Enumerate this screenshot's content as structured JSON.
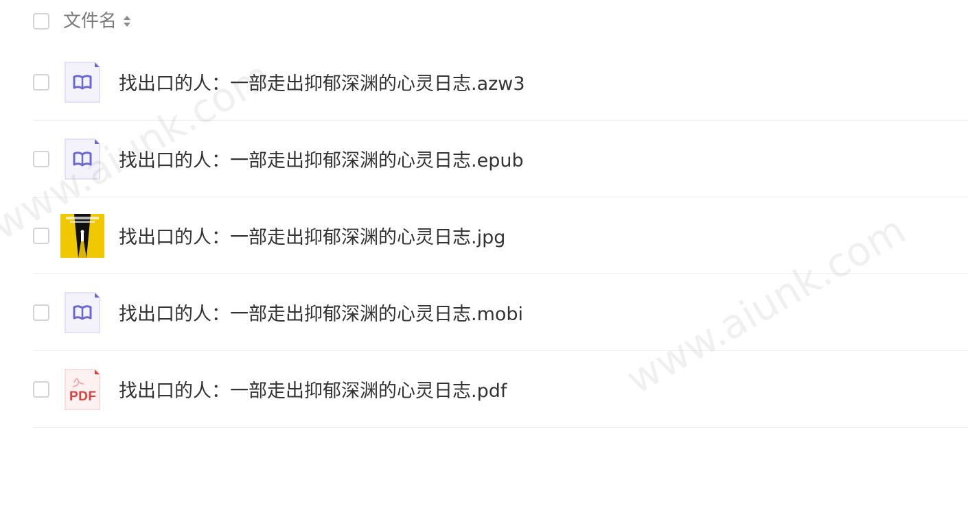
{
  "header": {
    "column_label": "文件名",
    "sort_icon": "sort-icon"
  },
  "files": [
    {
      "name": "找出口的人：一部走出抑郁深渊的心灵日志.azw3",
      "icon": "ebook-file-icon"
    },
    {
      "name": "找出口的人：一部走出抑郁深渊的心灵日志.epub",
      "icon": "ebook-file-icon"
    },
    {
      "name": "找出口的人：一部走出抑郁深渊的心灵日志.jpg",
      "icon": "image-thumbnail"
    },
    {
      "name": "找出口的人：一部走出抑郁深渊的心灵日志.mobi",
      "icon": "ebook-file-icon"
    },
    {
      "name": "找出口的人：一部走出抑郁深渊的心灵日志.pdf",
      "icon": "pdf-file-icon",
      "icon_text": "PDF"
    }
  ],
  "watermark": "www.aiunk.com",
  "colors": {
    "ebook_accent": "#6b68d6",
    "pdf_accent": "#e0403a",
    "image_bg": "#f0c800"
  }
}
